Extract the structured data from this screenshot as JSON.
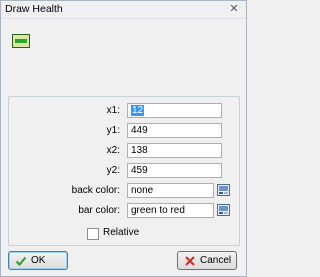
{
  "window": {
    "title": "Draw Health",
    "close_glyph": "✕"
  },
  "tool_icon": {
    "name": "health-bar-icon",
    "colors": {
      "frame": "#2e5e1f",
      "fill": "#d7e8a0",
      "bar": "#2da52a"
    }
  },
  "fields": {
    "x1": {
      "label": "x1:",
      "value": "12"
    },
    "y1": {
      "label": "y1:",
      "value": "449"
    },
    "x2": {
      "label": "x2:",
      "value": "138"
    },
    "y2": {
      "label": "y2:",
      "value": "459"
    },
    "back_color": {
      "label": "back color:",
      "value": "none"
    },
    "bar_color": {
      "label": "bar color:",
      "value": "green to red"
    }
  },
  "relative": {
    "label": "Relative",
    "checked": false
  },
  "buttons": {
    "ok_label": "OK",
    "cancel_label": "Cancel"
  },
  "icons": {
    "picker": "color-picker-icon",
    "ok": "check-icon",
    "cancel": "cross-icon"
  }
}
